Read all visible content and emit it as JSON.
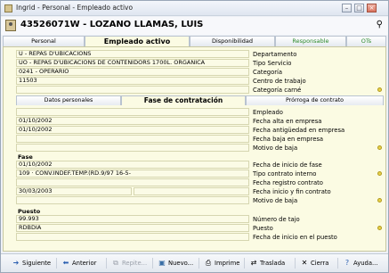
{
  "window": {
    "title": "Ingrid - Personal - Empleado activo",
    "minimize": "–",
    "maximize": "□",
    "close": "×"
  },
  "header": {
    "name": "43526071W - LOZANO LLAMAS, LUIS",
    "search_glyph": "⚲"
  },
  "main_tabs": [
    {
      "label": "Personal"
    },
    {
      "label": "Empleado activo"
    },
    {
      "label": "Disponibilidad"
    },
    {
      "label": "Responsable"
    },
    {
      "label": "OTs"
    }
  ],
  "top_fields": [
    {
      "value": "U - REPÁS D'UBICACIONS",
      "label": "Departamento"
    },
    {
      "value": "UO - REPÁS D'UBICACIONS DE CONTENIDORS 1700L. ORGANICA",
      "label": "Tipo Servicio"
    },
    {
      "value": "0241 - OPERARIO",
      "label": "Categoría"
    },
    {
      "value": "11503",
      "label": "Centro de trabajo"
    },
    {
      "value": "",
      "label": "Categoría carné"
    }
  ],
  "sub_tabs": [
    {
      "label": "Datos personales"
    },
    {
      "label": "Fase de contratación"
    },
    {
      "label": "Prórroga de contrato"
    }
  ],
  "contract": [
    {
      "value": "",
      "label": "Empleado"
    },
    {
      "value": "01/10/2002",
      "label": "Fecha alta en empresa"
    },
    {
      "value": "01/10/2002",
      "label": "Fecha antigüedad en empresa"
    },
    {
      "value": "",
      "label": "Fecha baja en empresa"
    },
    {
      "value": "",
      "label": "Motivo de baja"
    }
  ],
  "fase": {
    "section_label": "Fase",
    "rows": [
      {
        "value": "01/10/2002",
        "label": "Fecha de inicio de fase"
      },
      {
        "value": "109 · CONV.INDEF.TEMP.(RD.9/97 16-5-",
        "label": "Tipo contrato interno"
      },
      {
        "value": "",
        "label": "Fecha registro contrato"
      },
      {
        "value": "30/03/2003",
        "label": "Fecha inicio y fin contrato"
      },
      {
        "value": "",
        "label": "Motivo de baja"
      }
    ]
  },
  "puesto": {
    "section_label": "Puesto",
    "rows": [
      {
        "value": "99.993",
        "label": "Número de tajo"
      },
      {
        "value": "RDBDIA",
        "label": "Puesto"
      },
      {
        "value": "",
        "label": "Fecha de inicio en el puesto"
      }
    ]
  },
  "toolbar": {
    "siguiente": "Siguiente",
    "anterior": "Anterior",
    "repite": "Repite...",
    "nuevo": "Nuevo...",
    "imprime": "Imprime",
    "traslada": "Traslada",
    "cierra": "Cierra",
    "ayuda": "Ayuda..."
  },
  "colors": {
    "panel_bg": "#fbfbe3",
    "accent_green": "#2e8a2e",
    "required_dot": "#e8d24a"
  }
}
